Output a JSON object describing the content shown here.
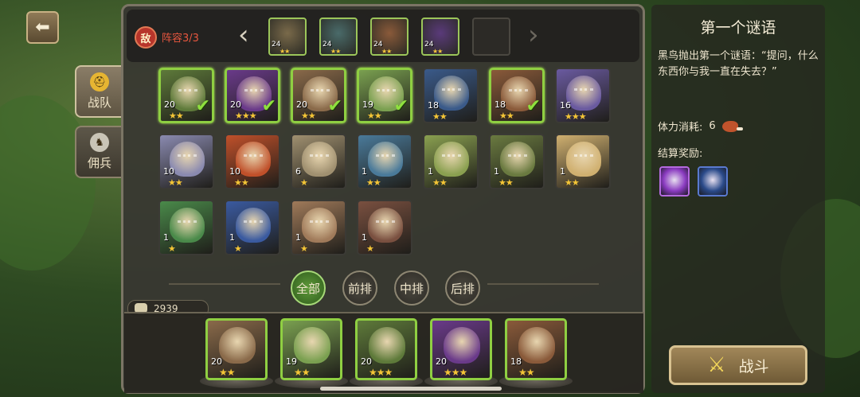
{
  "nav": {
    "back_icon": "back-arrow-icon"
  },
  "side_tabs": [
    {
      "label": "战队",
      "icon": "helmet-icon",
      "active": true
    },
    {
      "label": "佣兵",
      "icon": "knight-helmet-icon",
      "active": false
    }
  ],
  "enemy_bar": {
    "badge": "敌",
    "lineup": "阵容3/3",
    "prev_icon": "‹",
    "next_icon": "›",
    "slots": [
      {
        "level": "24",
        "stars": "★★",
        "color": "#7a6a4a"
      },
      {
        "level": "24",
        "stars": "★★",
        "color": "#4a6b6a"
      },
      {
        "level": "24",
        "stars": "★★",
        "color": "#8a5a3a"
      },
      {
        "level": "24",
        "stars": "★★",
        "color": "#5a3a7a"
      },
      {
        "level": "",
        "stars": "",
        "color": ""
      }
    ]
  },
  "heroes": [
    {
      "level": "20",
      "stars": "★★",
      "selected": true,
      "checked": true,
      "color": "#5e7a3a"
    },
    {
      "level": "20",
      "stars": "★★★",
      "selected": true,
      "checked": true,
      "color": "#6a3a8a"
    },
    {
      "level": "20",
      "stars": "★★",
      "selected": true,
      "checked": true,
      "color": "#8a6a4a"
    },
    {
      "level": "19",
      "stars": "★★",
      "selected": true,
      "checked": true,
      "color": "#7aa050"
    },
    {
      "level": "18",
      "stars": "★★",
      "selected": false,
      "checked": false,
      "color": "#3a5a8a"
    },
    {
      "level": "18",
      "stars": "★★",
      "selected": true,
      "checked": true,
      "color": "#8a5a3a"
    },
    {
      "level": "16",
      "stars": "★★★",
      "selected": false,
      "checked": false,
      "color": "#6a5aa0"
    },
    {
      "level": "10",
      "stars": "★★",
      "selected": false,
      "checked": false,
      "color": "#8a8ab0"
    },
    {
      "level": "10",
      "stars": "★★",
      "selected": false,
      "checked": false,
      "color": "#c0502a"
    },
    {
      "level": "6",
      "stars": "★",
      "selected": false,
      "checked": false,
      "color": "#a09070"
    },
    {
      "level": "1",
      "stars": "★★",
      "selected": false,
      "checked": false,
      "color": "#4a7a9a"
    },
    {
      "level": "1",
      "stars": "★★",
      "selected": false,
      "checked": false,
      "color": "#8aa050"
    },
    {
      "level": "1",
      "stars": "★★",
      "selected": false,
      "checked": false,
      "color": "#6a7a40"
    },
    {
      "level": "1",
      "stars": "★★",
      "selected": false,
      "checked": false,
      "color": "#d0b070"
    },
    {
      "level": "1",
      "stars": "★",
      "selected": false,
      "checked": false,
      "color": "#4a8a4a"
    },
    {
      "level": "1",
      "stars": "★",
      "selected": false,
      "checked": false,
      "color": "#3a5aa0"
    },
    {
      "level": "1",
      "stars": "★",
      "selected": false,
      "checked": false,
      "color": "#a07a5a"
    },
    {
      "level": "1",
      "stars": "★",
      "selected": false,
      "checked": false,
      "color": "#7a5040"
    }
  ],
  "filters": [
    {
      "label": "全部",
      "active": true
    },
    {
      "label": "前排",
      "active": false
    },
    {
      "label": "中排",
      "active": false
    },
    {
      "label": "后排",
      "active": false
    }
  ],
  "power": {
    "value": "2939",
    "icon": "fist-icon"
  },
  "team": [
    {
      "level": "20",
      "stars": "★★",
      "color": "#8a6a4a"
    },
    {
      "level": "19",
      "stars": "★★",
      "color": "#7aa050"
    },
    {
      "level": "20",
      "stars": "★★★",
      "color": "#5e7a3a"
    },
    {
      "level": "20",
      "stars": "★★★",
      "color": "#6a3a8a"
    },
    {
      "level": "18",
      "stars": "★★",
      "color": "#8a5a3a"
    }
  ],
  "info": {
    "title": "第一个谜语",
    "description": "黑鸟抛出第一个谜语：“提问，什么东西你与我一直在失去？”",
    "stamina_label": "体力消耗:",
    "stamina_value": "6",
    "stamina_icon": "meat-icon",
    "rewards_label": "结算奖励:",
    "rewards": [
      {
        "icon": "scroll-icon",
        "color": "#8a3ac0"
      },
      {
        "icon": "orb-staff-icon",
        "color": "#2a4a8a"
      }
    ]
  },
  "fight_button": {
    "label": "战斗",
    "icon": "crossed-swords-icon"
  }
}
